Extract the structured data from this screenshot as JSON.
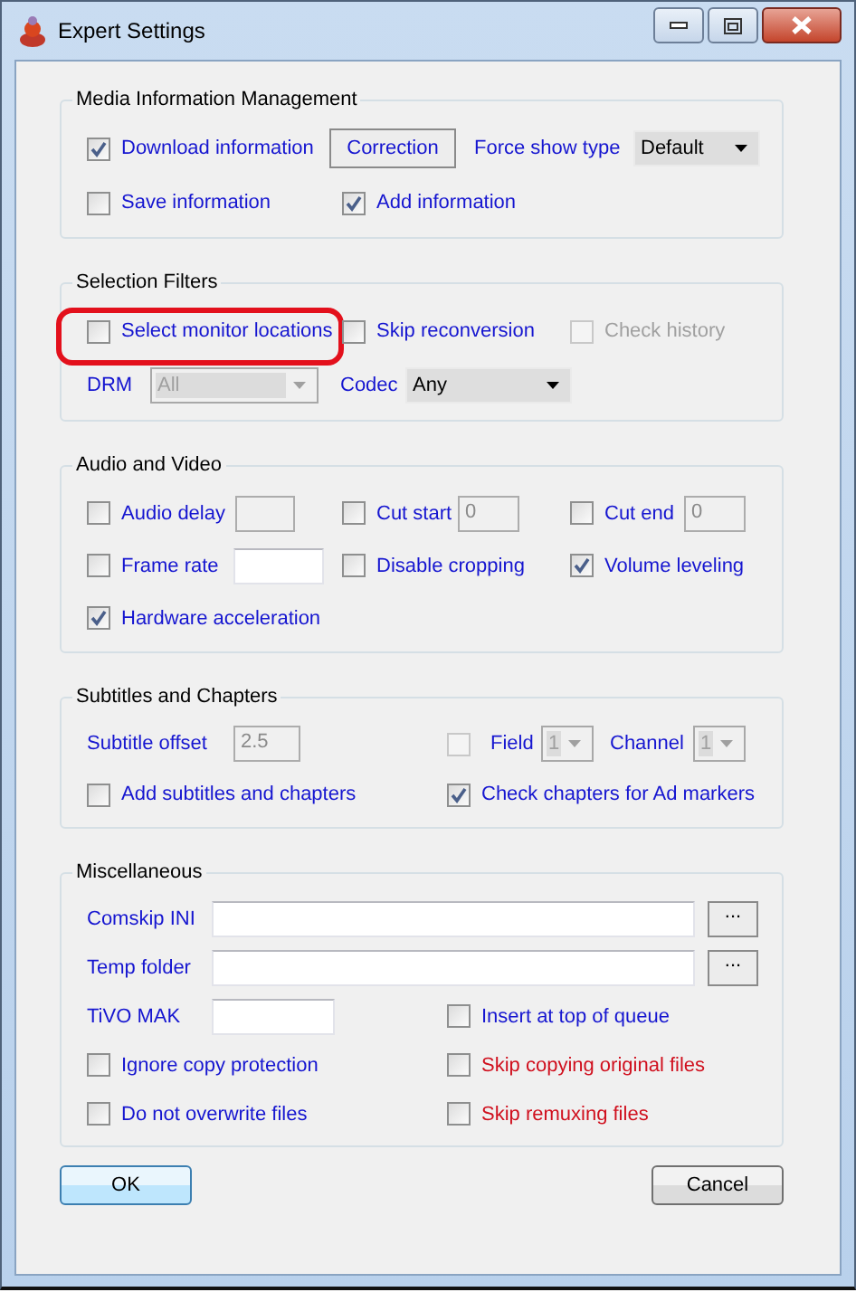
{
  "window": {
    "title": "Expert Settings"
  },
  "groups": [
    {
      "title": "Media Information Management",
      "rows": [
        {
          "items": [
            {
              "kind": "checkbox",
              "label": "Download information",
              "checked": true,
              "disabled": false
            },
            {
              "kind": "button",
              "label": "Correction"
            },
            {
              "kind": "label",
              "text": "Force show type"
            },
            {
              "kind": "dropdown",
              "value": "Default",
              "disabled": false
            }
          ]
        },
        {
          "items": [
            {
              "kind": "checkbox",
              "label": "Save information",
              "checked": false,
              "disabled": false
            },
            {
              "kind": "checkbox",
              "label": "Add information",
              "checked": true,
              "disabled": false
            }
          ]
        }
      ]
    },
    {
      "title": "Selection Filters",
      "rows": [
        {
          "items": [
            {
              "kind": "checkbox",
              "label": "Select monitor locations",
              "checked": false,
              "disabled": false,
              "highlighted": true
            },
            {
              "kind": "checkbox",
              "label": "Skip reconversion",
              "checked": false,
              "disabled": false,
              "highlighted": false
            },
            {
              "kind": "checkbox",
              "label": "Check history",
              "checked": false,
              "disabled": true,
              "highlighted": false
            }
          ]
        },
        {
          "items": [
            {
              "kind": "label",
              "text": "DRM"
            },
            {
              "kind": "dropdown",
              "value": "All",
              "disabled": true
            },
            {
              "kind": "label",
              "text": "Codec"
            },
            {
              "kind": "dropdown",
              "value": "Any",
              "disabled": false
            }
          ]
        }
      ]
    },
    {
      "title": "Audio and Video",
      "rows": [
        {
          "items": [
            {
              "kind": "checkbox",
              "label": "Audio delay",
              "checked": false,
              "disabled": false
            },
            {
              "kind": "textbox",
              "disabled": true
            },
            {
              "kind": "checkbox",
              "label": "Cut start",
              "checked": false,
              "disabled": false
            },
            {
              "kind": "textbox",
              "value": "0",
              "disabled": true
            },
            {
              "kind": "checkbox",
              "label": "Cut end",
              "checked": false,
              "disabled": false
            },
            {
              "kind": "textbox",
              "value": "0",
              "disabled": true
            }
          ]
        },
        {
          "items": [
            {
              "kind": "checkbox",
              "label": "Frame rate",
              "checked": false,
              "disabled": false
            },
            {
              "kind": "textbox",
              "disabled": false
            },
            {
              "kind": "checkbox",
              "label": "Disable cropping",
              "checked": false,
              "disabled": false
            },
            {
              "kind": "checkbox",
              "label": "Volume leveling",
              "checked": true,
              "disabled": false
            }
          ]
        },
        {
          "items": [
            {
              "kind": "checkbox",
              "label": "Hardware acceleration",
              "checked": true,
              "disabled": false
            }
          ]
        }
      ]
    },
    {
      "title": "Subtitles and Chapters",
      "rows": [
        {
          "items": [
            {
              "kind": "label",
              "text": "Subtitle offset"
            },
            {
              "kind": "textbox",
              "value": "2.5",
              "disabled": true
            },
            {
              "kind": "checkbox",
              "checked": false,
              "disabled": true
            },
            {
              "kind": "label",
              "text": "Field"
            },
            {
              "kind": "dropdown",
              "value": "1",
              "disabled": true
            },
            {
              "kind": "label",
              "text": "Channel"
            },
            {
              "kind": "dropdown",
              "value": "1",
              "disabled": true
            }
          ]
        },
        {
          "items": [
            {
              "kind": "checkbox",
              "label": "Add subtitles and chapters",
              "checked": false,
              "disabled": false
            },
            {
              "kind": "checkbox",
              "label": "Check chapters for Ad markers",
              "checked": true,
              "disabled": false
            }
          ]
        }
      ]
    },
    {
      "title": "Miscellaneous",
      "rows": [
        {
          "items": [
            {
              "kind": "label",
              "text": "Comskip INI"
            },
            {
              "kind": "textbox",
              "disabled": false
            },
            {
              "kind": "browse",
              "label": "..."
            }
          ]
        },
        {
          "items": [
            {
              "kind": "label",
              "text": "Temp folder"
            },
            {
              "kind": "textbox",
              "disabled": false
            },
            {
              "kind": "browse",
              "label": "..."
            }
          ]
        },
        {
          "items": [
            {
              "kind": "label",
              "text": "TiVO MAK"
            },
            {
              "kind": "textbox",
              "disabled": false
            },
            {
              "kind": "checkbox",
              "label": "Insert at top of queue",
              "checked": false,
              "disabled": false,
              "warning": false
            }
          ]
        },
        {
          "items": [
            {
              "kind": "checkbox",
              "label": "Ignore copy protection",
              "checked": false,
              "disabled": false,
              "warning": false
            },
            {
              "kind": "checkbox",
              "label": "Skip copying original files",
              "checked": false,
              "disabled": false,
              "warning": true
            }
          ]
        },
        {
          "items": [
            {
              "kind": "checkbox",
              "label": "Do not overwrite files",
              "checked": false,
              "disabled": false,
              "warning": false
            },
            {
              "kind": "checkbox",
              "label": "Skip remuxing files",
              "checked": false,
              "disabled": false,
              "warning": true
            }
          ]
        }
      ]
    }
  ],
  "buttons": [
    {
      "label": "OK",
      "default": true
    },
    {
      "label": "Cancel",
      "default": false
    }
  ]
}
